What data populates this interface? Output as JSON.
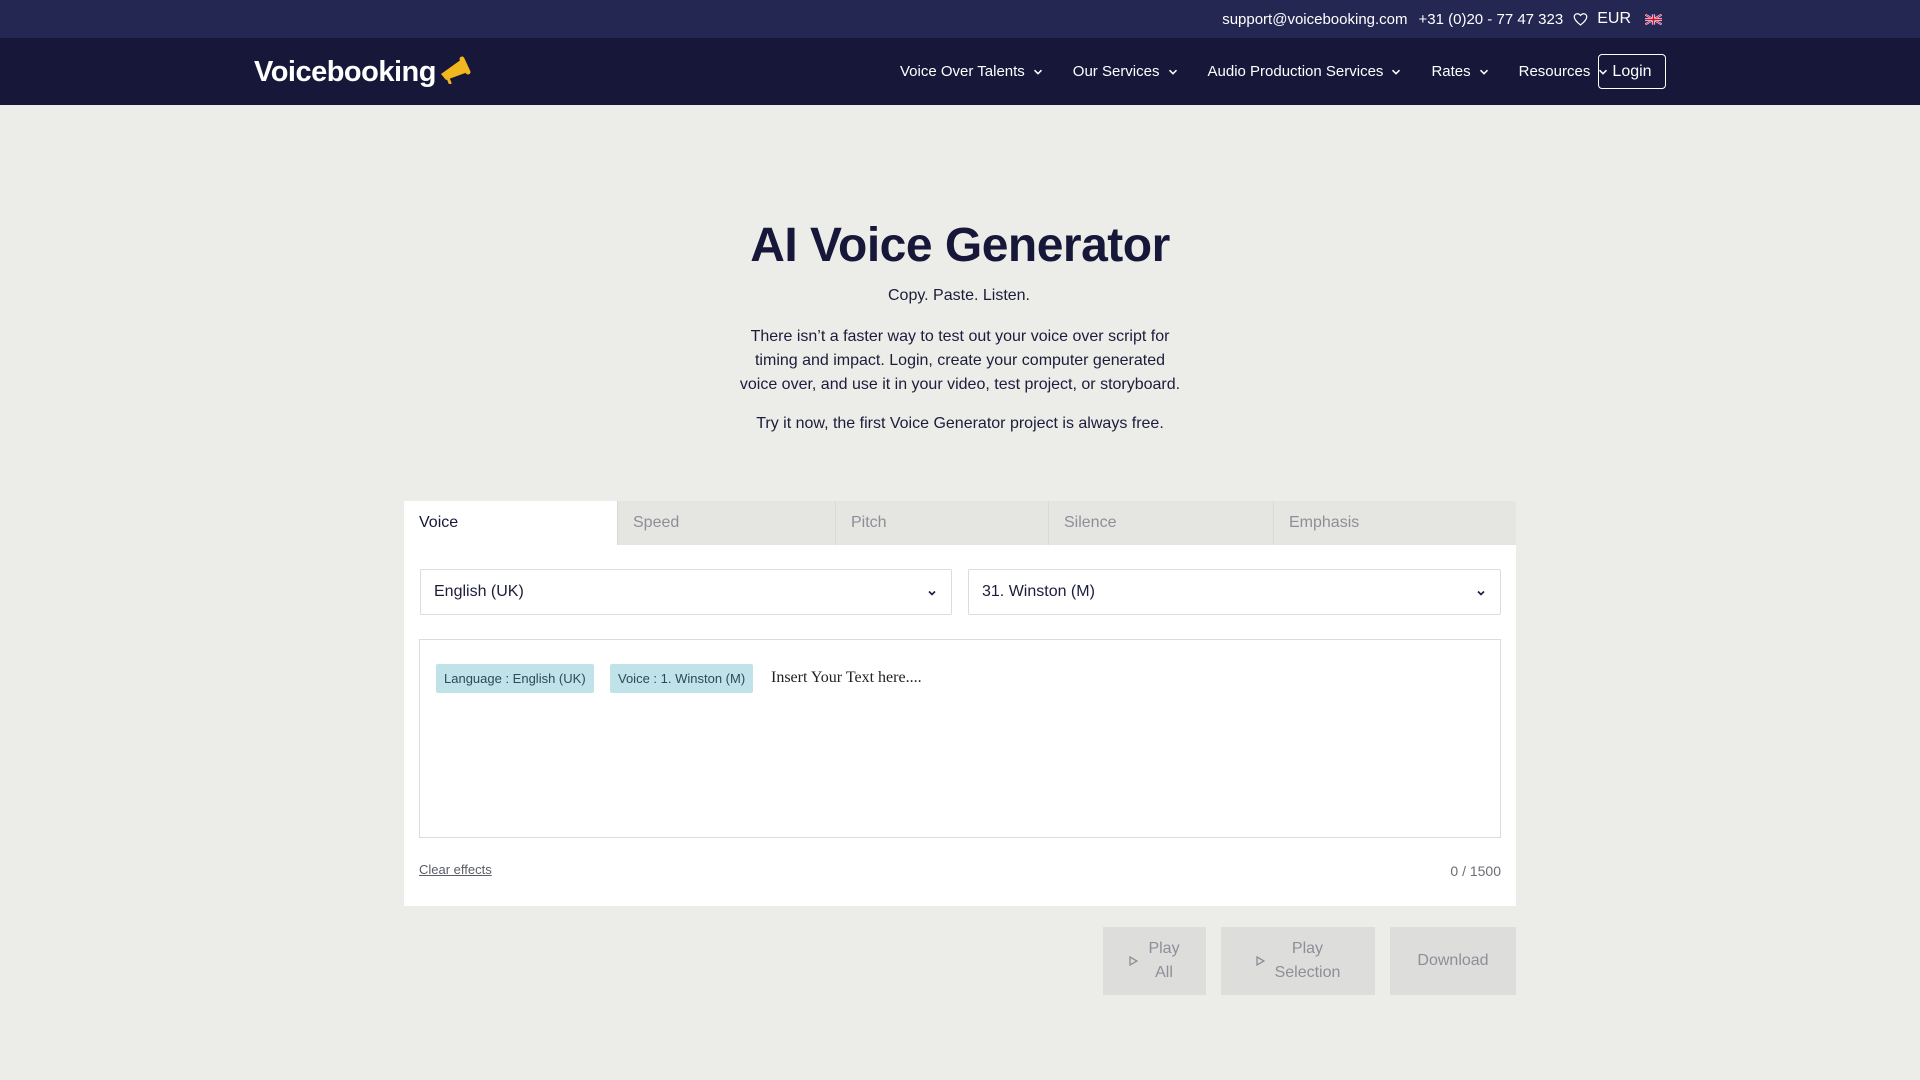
{
  "topbar": {
    "email": "support@voicebooking.com",
    "phone": "+31 (0)20 - 77 47 323",
    "currency": "EUR",
    "icons": {
      "favorites": "heart-icon",
      "language": "uk-flag-icon"
    }
  },
  "navbar": {
    "logo": "Voicebooking",
    "items": [
      {
        "label": "Voice Over Talents"
      },
      {
        "label": "Our Services"
      },
      {
        "label": "Audio Production Services"
      },
      {
        "label": "Rates"
      },
      {
        "label": "Resources"
      }
    ],
    "login": "Login"
  },
  "hero": {
    "title": "AI Voice Generator",
    "subtitle": "Copy. Paste. Listen.",
    "description": "There isn’t a faster way to test out your voice over script for timing and impact. Login, create your computer generated voice over, and use it in your video, test project, or storyboard.",
    "try_text": "Try it now, the first Voice Generator project is always free."
  },
  "generator": {
    "tabs": [
      "Voice",
      "Speed",
      "Pitch",
      "Silence",
      "Emphasis"
    ],
    "active_tab": "Voice",
    "language_select": "English (UK)",
    "voice_select": "31. Winston (M)",
    "tags": {
      "language": "Language : English (UK)",
      "voice": "Voice : 1. Winston (M)"
    },
    "placeholder": "Insert Your Text here....",
    "clear_effects": "Clear effects",
    "counter": "0 / 1500"
  },
  "actions": {
    "play_all_line1": "Play",
    "play_all_line2": "All",
    "play_selection_line1": "Play",
    "play_selection_line2": "Selection",
    "download": "Download"
  },
  "colors": {
    "topbar": "#242752",
    "navbar": "#161739",
    "background": "#ecece8",
    "tag": "#bfe3e8",
    "logo_accent": "#f2b61f"
  }
}
